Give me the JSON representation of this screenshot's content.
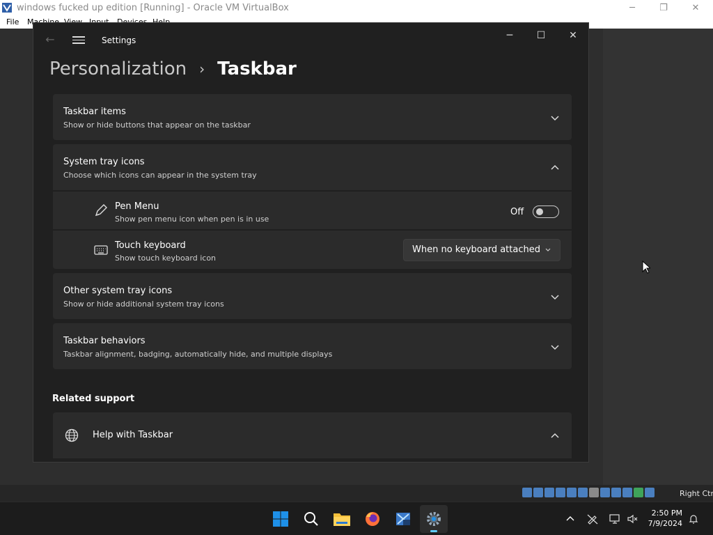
{
  "host": {
    "title": "windows fucked up edition [Running] - Oracle VM VirtualBox",
    "menu": [
      "File",
      "Machine",
      "View",
      "Input",
      "Devices",
      "Help"
    ],
    "controls": {
      "minimize": "─",
      "restore": "❐",
      "close": "✕"
    },
    "host_key": "Right Ctrl"
  },
  "settings": {
    "app_title": "Settings",
    "back_glyph": "←",
    "controls": {
      "minimize": "─",
      "maximize": "☐",
      "close": "✕"
    },
    "breadcrumb": {
      "parent": "Personalization",
      "separator": "›",
      "current": "Taskbar"
    },
    "cards": {
      "taskbar_items": {
        "title": "Taskbar items",
        "subtitle": "Show or hide buttons that appear on the taskbar",
        "state": "collapsed"
      },
      "system_tray": {
        "title": "System tray icons",
        "subtitle": "Choose which icons can appear in the system tray",
        "state": "expanded"
      },
      "pen_menu": {
        "title": "Pen Menu",
        "subtitle": "Show pen menu icon when pen is in use",
        "toggle_label": "Off",
        "icon": "pen-icon"
      },
      "touch_keyboard": {
        "title": "Touch keyboard",
        "subtitle": "Show touch keyboard icon",
        "dropdown_value": "When no keyboard attached",
        "icon": "keyboard-icon"
      },
      "other_tray": {
        "title": "Other system tray icons",
        "subtitle": "Show or hide additional system tray icons",
        "state": "collapsed"
      },
      "behaviors": {
        "title": "Taskbar behaviors",
        "subtitle": "Taskbar alignment, badging, automatically hide, and multiple displays",
        "state": "collapsed"
      }
    },
    "related_support": {
      "heading": "Related support",
      "help_title": "Help with Taskbar",
      "icon": "globe-icon"
    }
  },
  "taskbar": {
    "time": "2:50 PM",
    "date": "7/9/2024",
    "apps": [
      "windows-logo-icon",
      "search-icon",
      "file-explorer-icon",
      "firefox-icon",
      "xp-app-icon",
      "settings-icon"
    ]
  },
  "colors": {
    "accent": "#60cdff",
    "window_bg": "#202020",
    "card_bg": "#2b2b2b"
  }
}
